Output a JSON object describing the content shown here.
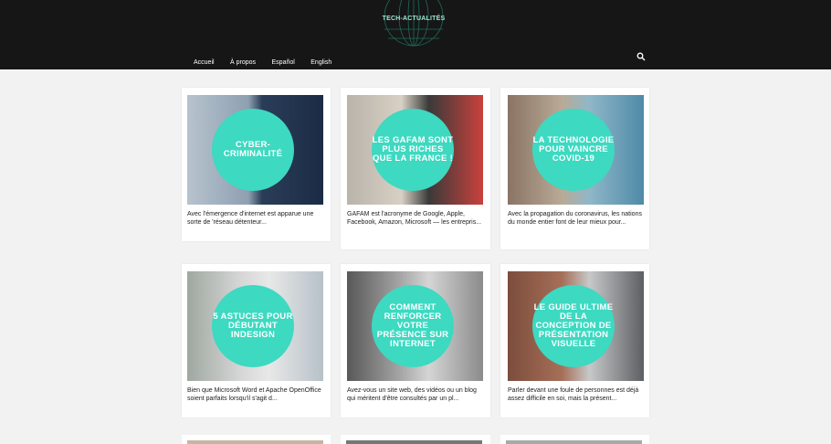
{
  "site": {
    "logo_text": "TECH-ACTUALITÉS"
  },
  "nav": {
    "items": [
      "Accueil",
      "À propos",
      "Español",
      "English"
    ]
  },
  "icons": {
    "search": "search-icon"
  },
  "colors": {
    "header_bg": "#161616",
    "accent": "#3dd9c1",
    "page_bg": "#f2f2f2"
  },
  "cards": [
    {
      "title": "CYBER-\nCRIMINALITÉ",
      "excerpt": "Avec l'émergence d'internet est apparue une sorte de 'réseau détenteur..."
    },
    {
      "title": "LES GAFAM SONT PLUS RICHES QUE LA FRANCE !",
      "excerpt": "GAFAM est l'acronyme de Google, Apple, Facebook, Amazon, Microsoft — les entrepris..."
    },
    {
      "title": "LA TECHNOLOGIE POUR VAINCRE COVID-19",
      "excerpt": "Avec la propagation du coronavirus, les nations du monde entier font de leur mieux pour..."
    },
    {
      "title": "5 ASTUCES POUR DÉBUTANT INDESIGN",
      "excerpt": "Bien que Microsoft Word et Apache OpenOffice soient parfaits lorsqu'il s'agit d..."
    },
    {
      "title": "COMMENT RENFORCER VOTRE PRÉSENCE SUR INTERNET",
      "excerpt": "Avez-vous un site web, des vidéos ou un blog qui méritent d'être consultés par un pl..."
    },
    {
      "title": "LE GUIDE ULTIME DE LA CONCEPTION DE PRÉSENTATION VISUELLE",
      "excerpt": "Parler devant une foule de personnes est déjà assez difficile en soi, mais la présent..."
    }
  ]
}
